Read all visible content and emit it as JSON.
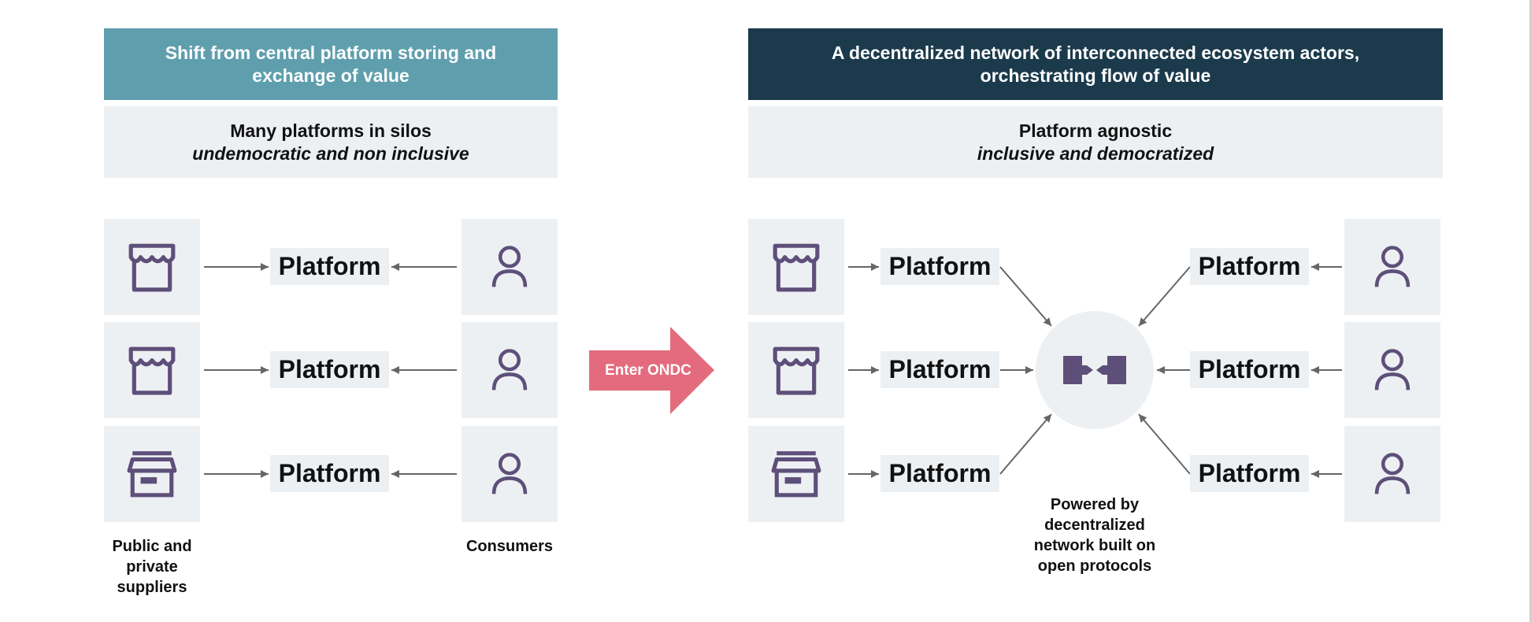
{
  "colors": {
    "left_header_bg": "#5f9ead",
    "right_header_bg": "#1b3a4c",
    "panel_bg": "#edf0f3",
    "icon_color": "#5e4f7a",
    "arrow_color": "#666666",
    "enter_arrow_color": "#e36b7d"
  },
  "left": {
    "header": "Shift from central platform storing and exchange of value",
    "subheader_title": "Many platforms in silos",
    "subheader_subtitle": "undemocratic and non inclusive",
    "rows": [
      {
        "supplier_icon": "storefront-icon",
        "platform": "Platform",
        "consumer_icon": "person-icon"
      },
      {
        "supplier_icon": "storefront-icon",
        "platform": "Platform",
        "consumer_icon": "person-icon"
      },
      {
        "supplier_icon": "archive-box-icon",
        "platform": "Platform",
        "consumer_icon": "person-icon"
      }
    ],
    "supplier_caption": "Public and private suppliers",
    "consumer_caption": "Consumers"
  },
  "transition": {
    "label": "Enter ONDC"
  },
  "right": {
    "header": "A decentralized network of interconnected ecosystem actors, orchestrating flow of value",
    "subheader_title": "Platform agnostic",
    "subheader_subtitle": "inclusive and democratized",
    "left_rows": [
      {
        "supplier_icon": "storefront-icon",
        "platform": "Platform"
      },
      {
        "supplier_icon": "storefront-icon",
        "platform": "Platform"
      },
      {
        "supplier_icon": "archive-box-icon",
        "platform": "Platform"
      }
    ],
    "right_rows": [
      {
        "platform": "Platform",
        "consumer_icon": "person-icon"
      },
      {
        "platform": "Platform",
        "consumer_icon": "person-icon"
      },
      {
        "platform": "Platform",
        "consumer_icon": "person-icon"
      }
    ],
    "hub_icon": "network-connect-icon",
    "hub_caption": "Powered by decentralized network built on open protocols"
  }
}
